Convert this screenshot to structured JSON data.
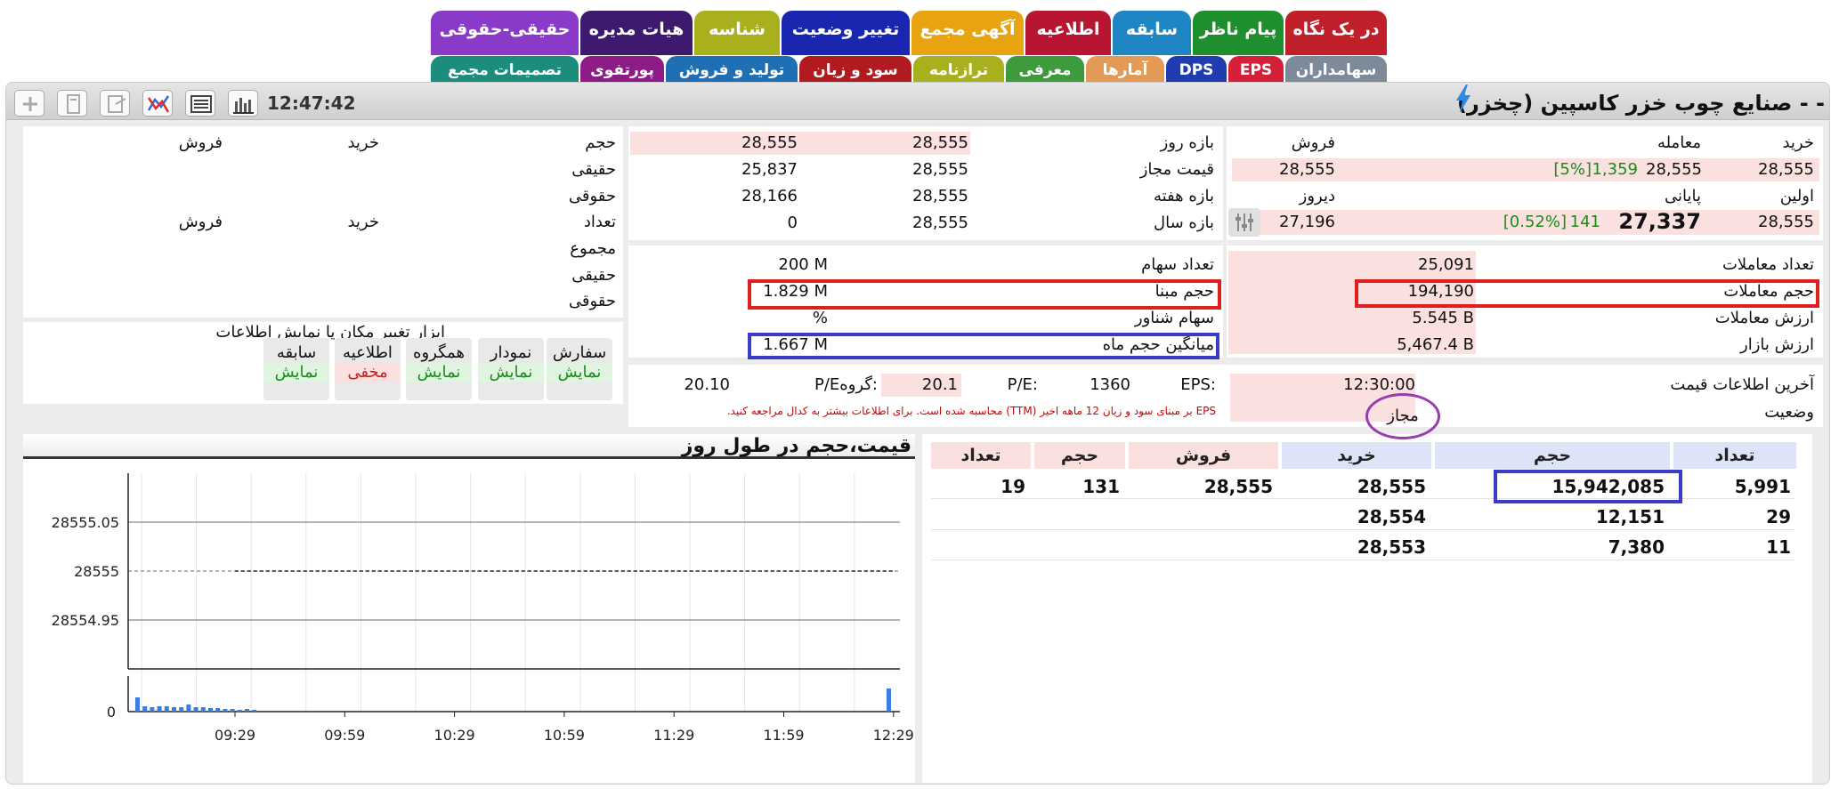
{
  "tabs_row1": [
    {
      "label": "در یک نگاه",
      "color": "#c0202a"
    },
    {
      "label": "پیام ناظر",
      "color": "#1f8f2d"
    },
    {
      "label": "سابقه",
      "color": "#1f86c4"
    },
    {
      "label": "اطلاعیه",
      "color": "#b71532"
    },
    {
      "label": "آگهی مجمع",
      "color": "#e8a311"
    },
    {
      "label": "تغییر وضعیت",
      "color": "#1826b0"
    },
    {
      "label": "شناسه",
      "color": "#a9b01d"
    },
    {
      "label": "هیات مدیره",
      "color": "#3e1a6e"
    },
    {
      "label": "حقیقی-حقوقی",
      "color": "#8a3ac9"
    }
  ],
  "tabs_row2": [
    {
      "label": "سهامداران",
      "color": "#7d8a99"
    },
    {
      "label": "EPS",
      "color": "#d6203a"
    },
    {
      "label": "DPS",
      "color": "#1f3db0"
    },
    {
      "label": "آمارها",
      "color": "#e29a56"
    },
    {
      "label": "معرفی",
      "color": "#3d9a3d"
    },
    {
      "label": "ترازنامه",
      "color": "#a9b01d"
    },
    {
      "label": "سود و زیان",
      "color": "#b11a1f"
    },
    {
      "label": "تولید و فروش",
      "color": "#1f6fb5"
    },
    {
      "label": "پورتفوی",
      "color": "#8e1c86"
    },
    {
      "label": "تصمیمات مجمع",
      "color": "#1c8c7c"
    }
  ],
  "header": {
    "title": "صنایع چوب خزر کاسپین (چخزر) - -",
    "time": "12:47:42"
  },
  "trade": {
    "col_buy": "خرید",
    "col_trade": "معامله",
    "col_sell": "فروش",
    "buy_price": "28,555",
    "last_price": "28,555",
    "last_vol": "1,359",
    "last_pct": "[5%]",
    "sell_price": "28,555",
    "col_first": "اولین",
    "col_close": "پایانی",
    "col_yesterday": "دیروز",
    "first_price": "28,555",
    "close_price": "27,337",
    "close_vol": "141",
    "close_pct": "[0.52%]",
    "yesterday_price": "27,196"
  },
  "ranges": {
    "day_label": "بازه روز",
    "day_low": "28,555",
    "day_high": "28,555",
    "allowed_label": "قیمت مجاز",
    "allowed_low": "28,555",
    "allowed_high": "25,837",
    "week_label": "بازه هفته",
    "week_low": "28,555",
    "week_high": "28,166",
    "year_label": "بازه سال",
    "year_low": "28,555",
    "year_high": "0"
  },
  "stats_left": {
    "count_label": "تعداد معاملات",
    "count": "25,091",
    "volume_label": "حجم معاملات",
    "volume": "194,190",
    "value_label": "ارزش معاملات",
    "value": "5.545 B",
    "market_label": "ارزش بازار",
    "market": "5,467.4 B"
  },
  "stats_mid": {
    "shares_label": "تعداد سهام",
    "shares": "200 M",
    "base_label": "حجم مبنا",
    "base": "1.829 M",
    "float_label": "سهام شناور",
    "float": "%",
    "avg_label": "میانگین حجم ماه",
    "avg": "1.667 M"
  },
  "info": {
    "last_label": "آخرین اطلاعات قیمت",
    "last_time": "12:30:00",
    "status_label": "وضعیت",
    "status": "مجاز",
    "eps_label": "EPS:",
    "eps": "1360",
    "pe_label": "P/E:",
    "pe": "20.1",
    "gpe_label": "P/Eگروه:",
    "gpe": "20.10",
    "note": "EPS بر مبنای سود و زیان 12 ماهه اخیر (TTM) محاسبه شده است. برای اطلاعات بیشتر به کدال مراجعه کنید."
  },
  "client": {
    "vol": "حجم",
    "buy": "خرید",
    "sell": "فروش",
    "real": "حقیقی",
    "legal": "حقوقی",
    "count": "تعداد",
    "total": "مجموع"
  },
  "tools": {
    "title": "ابزار تغییر مکان یا نمایش اطلاعات",
    "items": [
      {
        "label": "سفارش",
        "state": "نمایش",
        "color": "#1a8c1a"
      },
      {
        "label": "نمودار",
        "state": "نمایش",
        "color": "#1a8c1a"
      },
      {
        "label": "همگروه",
        "state": "نمایش",
        "color": "#1a8c1a"
      },
      {
        "label": "اطلاعیه",
        "state": "مخفی",
        "color": "#c81e1e"
      },
      {
        "label": "سابقه",
        "state": "نمایش",
        "color": "#1a8c1a"
      }
    ]
  },
  "orderbook": {
    "headers": {
      "count": "تعداد",
      "volume": "حجم",
      "buy": "خرید",
      "sell": "فروش",
      "svolume": "حجم",
      "scount": "تعداد"
    },
    "rows": [
      {
        "count": "5,991",
        "volume": "15,942,085",
        "buy": "28,555",
        "sell": "28,555",
        "svolume": "131",
        "scount": "19"
      },
      {
        "count": "29",
        "volume": "12,151",
        "buy": "28,554",
        "sell": "",
        "svolume": "",
        "scount": ""
      },
      {
        "count": "11",
        "volume": "7,380",
        "buy": "28,553",
        "sell": "",
        "svolume": "",
        "scount": ""
      }
    ]
  },
  "chart_data": {
    "type": "line",
    "title": "قیمت،حجم در طول روز",
    "x": [
      "09:29",
      "09:59",
      "10:29",
      "10:59",
      "11:29",
      "11:59",
      "12:29"
    ],
    "y_ticks": [
      28555.05,
      28555,
      28554.95
    ],
    "ylim": [
      28554.9,
      28555.1
    ],
    "price_series": [
      28555,
      28555,
      28555,
      28555,
      28555,
      28555,
      28555
    ],
    "volume_ticks": [
      0
    ],
    "volume_bars": [
      16,
      6,
      5,
      6,
      6,
      5,
      5,
      8,
      5,
      5,
      4,
      4,
      3,
      3,
      2,
      3,
      2,
      26
    ],
    "grid": true,
    "colors": {
      "volume": "#3a7fe0",
      "price": "#333333"
    }
  }
}
